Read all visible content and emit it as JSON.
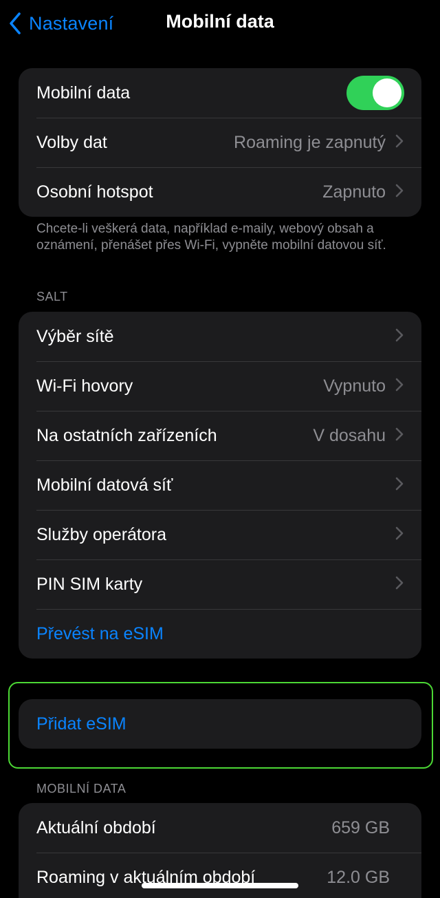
{
  "nav": {
    "back_label": "Nastavení",
    "title": "Mobilní data"
  },
  "group_main": {
    "mobile_data": {
      "label": "Mobilní data",
      "toggle_on": true
    },
    "data_options": {
      "label": "Volby dat",
      "value": "Roaming je zapnutý"
    },
    "hotspot": {
      "label": "Osobní hotspot",
      "value": "Zapnuto"
    }
  },
  "footnote": "Chcete-li veškerá data, například e-maily, webový obsah a oznámení, přenášet přes Wi-Fi, vypněte mobilní datovou síť.",
  "carrier_section": {
    "header": "SALT",
    "network_selection": {
      "label": "Výběr sítě"
    },
    "wifi_calling": {
      "label": "Wi-Fi hovory",
      "value": "Vypnuto"
    },
    "other_devices": {
      "label": "Na ostatních zařízeních",
      "value": "V dosahu"
    },
    "cellular_network": {
      "label": "Mobilní datová síť"
    },
    "carrier_services": {
      "label": "Služby operátora"
    },
    "sim_pin": {
      "label": "PIN SIM karty"
    },
    "convert_esim": {
      "label": "Převést na eSIM"
    }
  },
  "add_esim": {
    "label": "Přidat eSIM"
  },
  "usage_section": {
    "header": "MOBILNÍ DATA",
    "current_period": {
      "label": "Aktuální období",
      "value": "659 GB"
    },
    "roaming_current_period": {
      "label": "Roaming v aktuálním období",
      "value": "12.0 GB"
    }
  },
  "colors": {
    "accent": "#0a84ff",
    "toggle_on": "#30d158",
    "highlight_border": "#4cd835",
    "background": "#000000",
    "cell_background": "#1c1c1e",
    "secondary_text": "#8e8e93"
  },
  "icons": {
    "back": "chevron-left-icon",
    "disclosure": "chevron-right-icon"
  }
}
